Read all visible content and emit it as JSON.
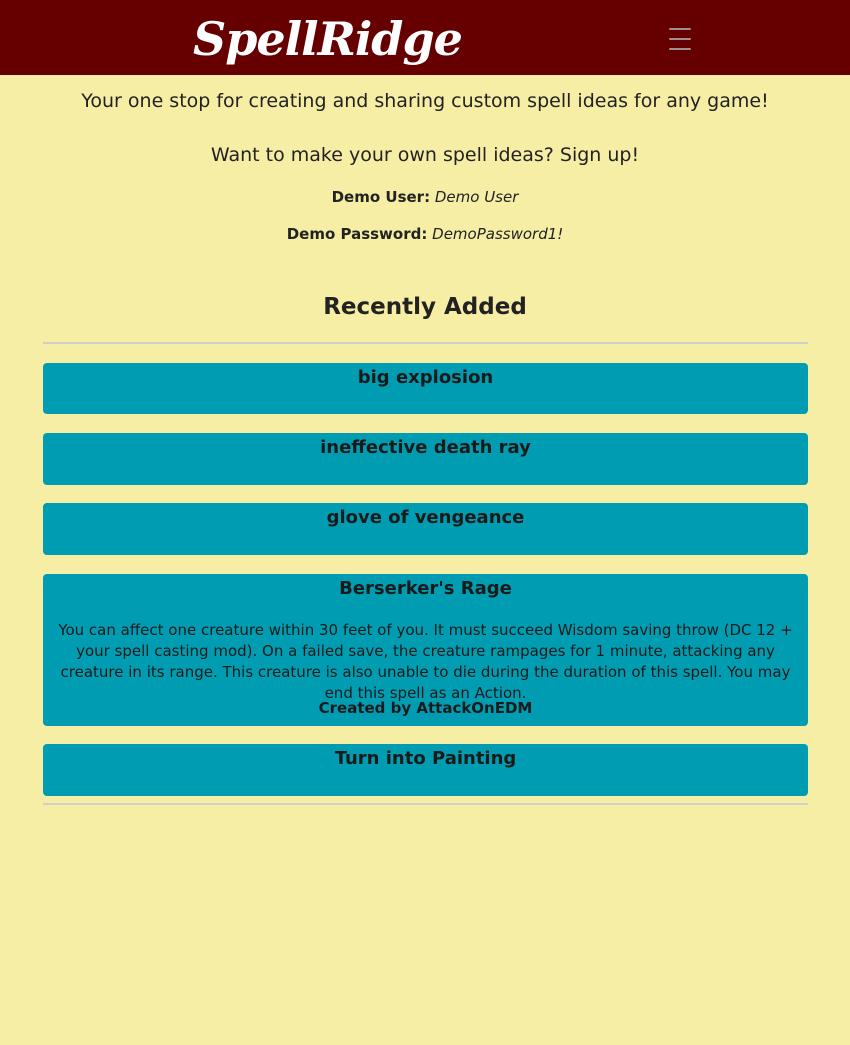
{
  "nav": {
    "brand": "SpellRidge",
    "menu_icon": "hamburger-menu-icon",
    "background_color": "#660000"
  },
  "intro": {
    "tagline": "Your one stop for creating and sharing custom spell ideas for any game!",
    "signup_prompt": "Want to make your own spell ideas? Sign up!",
    "demo_user_label": "Demo User:",
    "demo_user_value": "Demo User",
    "demo_password_label": "Demo Password:",
    "demo_password_value": "DemoPassword1!"
  },
  "recent": {
    "title": "Recently Added",
    "card_color": "#009db2",
    "spells": [
      {
        "name": "big explosion"
      },
      {
        "name": "ineffective death ray"
      },
      {
        "name": "glove of vengeance"
      },
      {
        "name": "Berserker's Rage",
        "description": "You can affect one creature within 30 feet of you. It must succeed Wisdom saving throw (DC 12 + your spell casting mod). On a failed save, the creature rampages for 1 minute, attacking any creature in its range. This creature is also unable to die during the duration of this spell. You may end this spell as an Action.",
        "author": "Created by AttackOnEDM"
      },
      {
        "name": "Turn into Painting"
      }
    ]
  },
  "page": {
    "background_color": "#f6eea5"
  }
}
